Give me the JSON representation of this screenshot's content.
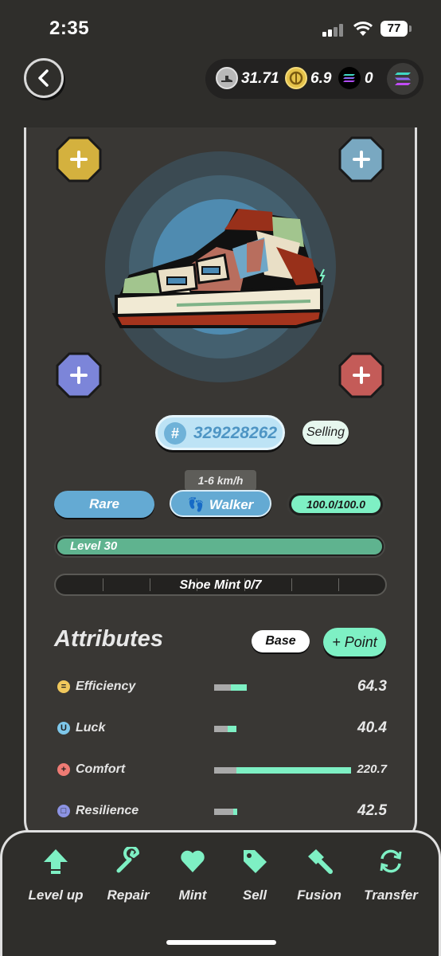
{
  "status_bar": {
    "time": "2:35",
    "battery": "77"
  },
  "wallet": {
    "gst": "31.71",
    "gmt": "6.9",
    "sol": "0"
  },
  "sneaker": {
    "id": "329228262",
    "status": "Selling",
    "speed_range": "1-6 km/h",
    "rarity": "Rare",
    "type": "Walker",
    "durability": "100.0/100.0",
    "durability_fraction": 1.0,
    "level_label": "Level 30",
    "level_fraction": 1.0,
    "mint_label": "Shoe Mint 0/7",
    "mint_segments": 7
  },
  "attributes": {
    "title": "Attributes",
    "base_label": "Base",
    "point_label": "+ Point",
    "items": [
      {
        "name": "Efficiency",
        "value": "64.3",
        "base": 12,
        "added": 12,
        "icon": "efficiency-icon",
        "color": "#f0c85c"
      },
      {
        "name": "Luck",
        "value": "40.4",
        "base": 10,
        "added": 6,
        "icon": "luck-icon",
        "color": "#7ec7ea"
      },
      {
        "name": "Comfort",
        "value": "220.7",
        "base": 16,
        "added": 84,
        "icon": "comfort-icon",
        "color": "#ef7b74"
      },
      {
        "name": "Resilience",
        "value": "42.5",
        "base": 14,
        "added": 3,
        "icon": "resilience-icon",
        "color": "#8c93e3"
      }
    ]
  },
  "nav": [
    {
      "label": "Level up",
      "icon": "level-up-arrow-icon"
    },
    {
      "label": "Repair",
      "icon": "wrench-icon"
    },
    {
      "label": "Mint",
      "icon": "heart-icon"
    },
    {
      "label": "Sell",
      "icon": "tag-icon"
    },
    {
      "label": "Fusion",
      "icon": "hammer-icon"
    },
    {
      "label": "Transfer",
      "icon": "transfer-icon"
    }
  ],
  "colors": {
    "accent": "#7ef0c4",
    "blue": "#64aad3",
    "level": "#5fb38f"
  }
}
